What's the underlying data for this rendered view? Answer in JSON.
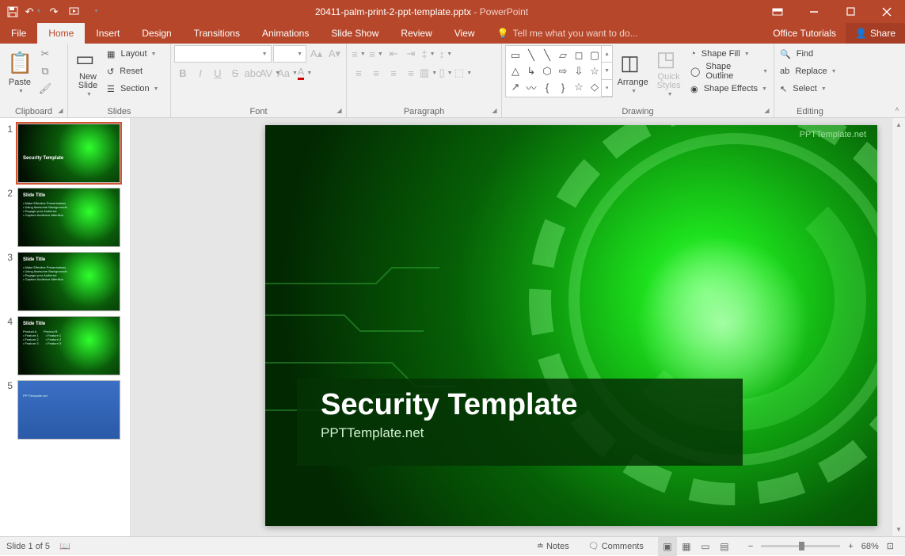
{
  "titlebar": {
    "filename": "20411-palm-print-2-ppt-template.pptx",
    "app": "PowerPoint"
  },
  "window": {
    "office_tutorials": "Office Tutorials",
    "share": "Share"
  },
  "tabs": {
    "file": "File",
    "home": "Home",
    "insert": "Insert",
    "design": "Design",
    "transitions": "Transitions",
    "animations": "Animations",
    "slideshow": "Slide Show",
    "review": "Review",
    "view": "View",
    "tellme": "Tell me what you want to do..."
  },
  "ribbon": {
    "clipboard": {
      "label": "Clipboard",
      "paste": "Paste"
    },
    "slides": {
      "label": "Slides",
      "new_slide": "New\nSlide",
      "layout": "Layout",
      "reset": "Reset",
      "section": "Section"
    },
    "font": {
      "label": "Font"
    },
    "paragraph": {
      "label": "Paragraph"
    },
    "drawing": {
      "label": "Drawing",
      "arrange": "Arrange",
      "quick_styles": "Quick\nStyles",
      "shape_fill": "Shape Fill",
      "shape_outline": "Shape Outline",
      "shape_effects": "Shape Effects"
    },
    "editing": {
      "label": "Editing",
      "find": "Find",
      "replace": "Replace",
      "select": "Select"
    }
  },
  "slide": {
    "title": "Security Template",
    "subtitle": "PPTTemplate.net",
    "watermark": "PPTTemplate.net"
  },
  "thumbs": [
    {
      "num": "1",
      "title": "Security Template",
      "type": "green",
      "selected": true
    },
    {
      "num": "2",
      "title": "Slide Title",
      "type": "green",
      "bullets": "• Make Effective Presentations\n• Using Awesome Backgrounds\n• Engage your Audience\n• Capture Audience Attention"
    },
    {
      "num": "3",
      "title": "Slide Title",
      "type": "green",
      "bullets": "• Make Effective Presentations\n• Using Awesome Backgrounds\n• Engage your Audience\n• Capture Audience Attention"
    },
    {
      "num": "4",
      "title": "Slide Title",
      "type": "green",
      "bullets": "Product A        Product B\n• Feature 1        • Feature 1\n• Feature 2        • Feature 2\n• Feature 3        • Feature 3"
    },
    {
      "num": "5",
      "title": "",
      "type": "blue",
      "bullets": "PPTTemplate.net"
    }
  ],
  "status": {
    "slide_info": "Slide 1 of 5",
    "notes": "Notes",
    "comments": "Comments",
    "zoom": "68%"
  }
}
